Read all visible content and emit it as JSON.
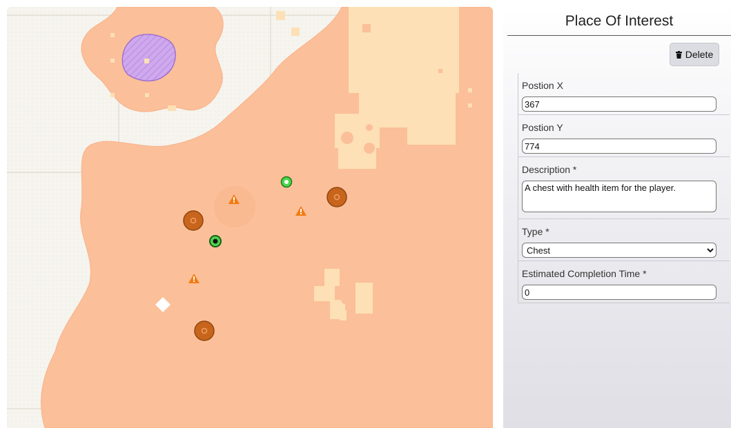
{
  "panel": {
    "title": "Place Of Interest",
    "delete_label": "Delete",
    "delete_icon": "trash-icon",
    "fields": {
      "position_x": {
        "label": "Postion X",
        "value": "367"
      },
      "position_y": {
        "label": "Postion Y",
        "value": "774"
      },
      "description": {
        "label": "Description *",
        "value": "A chest with health item for the player."
      },
      "type": {
        "label": "Type *",
        "value": "Chest",
        "options": [
          "Chest"
        ]
      },
      "completion_time": {
        "label": "Estimated Completion Time *",
        "value": "0"
      }
    }
  },
  "map": {
    "markers": [
      {
        "kind": "orange-circle-marker"
      },
      {
        "kind": "orange-circle-marker"
      },
      {
        "kind": "orange-circle-marker"
      },
      {
        "kind": "green-circle-marker"
      },
      {
        "kind": "green-selected-marker"
      },
      {
        "kind": "warning-triangle-marker"
      },
      {
        "kind": "warning-triangle-marker"
      },
      {
        "kind": "warning-triangle-marker"
      },
      {
        "kind": "white-diamond-marker"
      }
    ],
    "colors": {
      "terrain": "#fbbf99",
      "buildings": "#fde0b5",
      "restricted_zone": "#cda6ec",
      "marker_orange": "#c8651c",
      "marker_green": "#4cd64c",
      "warning": "#f07c12"
    }
  }
}
